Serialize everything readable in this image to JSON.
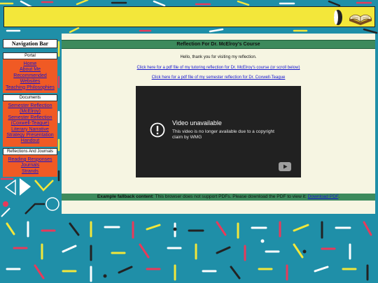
{
  "sidebar": {
    "title": "Navigation Bar",
    "sections": [
      {
        "label": "Portal",
        "links": [
          "Home",
          "About Me",
          "Recommended Websites",
          "Teaching Philosophies"
        ]
      },
      {
        "label": "Documents",
        "links": [
          "Semester Reflection (McElroy)",
          "Semester Reflection (Coxwell-Teague)",
          "Literary Narrative",
          "Strategy Presentation Handout"
        ]
      },
      {
        "label": "Reflections And Journals",
        "links": [
          "Reading Responses",
          "Journals",
          "Strands"
        ]
      }
    ]
  },
  "main": {
    "heading": "Reflection For Dr. McElroy's Course",
    "greeting": "Hello, thank you for visiting my reflection.",
    "link_tutoring": "Click here for a pdf file of my tutoring reflection for Dr. McElroy's course (or scroll below)",
    "link_semester": "Click here for a pdf file of my semester reflection for Dr. Coxwell-Teague",
    "video": {
      "title": "Video unavailable",
      "message": "This video is no longer available due to a copyright claim by WMG"
    },
    "fallback": {
      "label": "Example fallback content",
      "text": ": This browser does not support PDFs. Please download the PDF to view it: ",
      "link": "Download PDF",
      "end": "."
    }
  },
  "colors": {
    "background": "#1f8fa8",
    "banner": "#f3e73a",
    "sidebar_box": "#f05a24",
    "header_bar": "#3d8a5c",
    "content_bg": "#f6f5e2",
    "link": "#1515d0"
  }
}
